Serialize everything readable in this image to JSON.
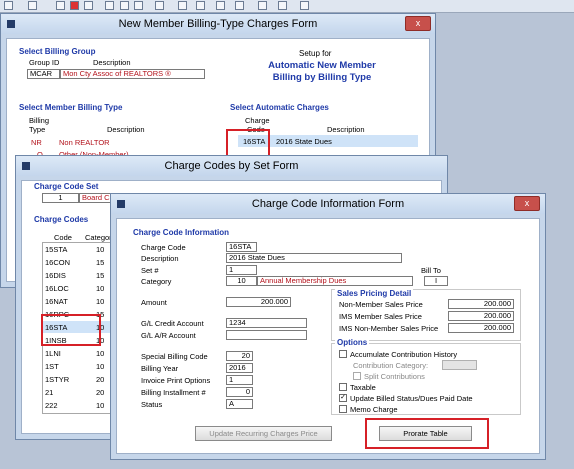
{
  "colors": {
    "accent": "#1f3aa8",
    "highlight": "#d62027",
    "window_bg": "#c6d6ea"
  },
  "toolbar": {
    "icons": [
      "print-icon",
      "pdf-icon",
      "edit-icon",
      "report-icon",
      "help-icon"
    ]
  },
  "billing_form": {
    "title": "New Member Billing-Type Charges Form",
    "close": "x",
    "select_billing_group": "Select Billing Group",
    "group_id_header": "Group ID",
    "description_header": "Description",
    "group_id": "MCAR",
    "group_desc": "Mon Cty Assoc of REALTORS ®",
    "setup_for": "Setup for",
    "setup_line1": "Automatic New Member",
    "setup_line2": "Billing by Billing Type",
    "select_member_billing_type": "Select Member Billing Type",
    "billing_type_header1": "Billing",
    "billing_type_header2": "Type",
    "bt_description_header": "Description",
    "billing_types": [
      {
        "code": "NR",
        "desc": "Non REALTOR"
      },
      {
        "code": "O",
        "desc": "Other (Non-Member)"
      }
    ],
    "select_automatic_charges": "Select Automatic Charges",
    "charge_code_header1": "Charge",
    "charge_code_header2": "Code",
    "ac_description_header": "Description",
    "auto_charge_code": "16STA",
    "auto_charge_desc": "2016 State Dues"
  },
  "set_form": {
    "title": "Charge Codes by Set Form",
    "charge_code_set": "Charge Code Set",
    "set_num": "1",
    "set_desc": "Board Cha",
    "charge_codes": "Charge Codes",
    "code_header": "Code",
    "category_header": "Categor",
    "codes": [
      {
        "code": "15STA",
        "cat": "10"
      },
      {
        "code": "16CON",
        "cat": "15"
      },
      {
        "code": "16DIS",
        "cat": "15"
      },
      {
        "code": "16LOC",
        "cat": "10"
      },
      {
        "code": "16NAT",
        "cat": "10"
      },
      {
        "code": "16RPC",
        "cat": "15"
      },
      {
        "code": "16STA",
        "cat": "10"
      },
      {
        "code": "1INSB",
        "cat": "10"
      },
      {
        "code": "1LNI",
        "cat": "10"
      },
      {
        "code": "1ST",
        "cat": "10"
      },
      {
        "code": "1STYR",
        "cat": "20"
      },
      {
        "code": "21",
        "cat": "20"
      },
      {
        "code": "222",
        "cat": "10"
      }
    ]
  },
  "info_form": {
    "title": "Charge Code Information Form",
    "close": "x",
    "section": "Charge Code Information",
    "charge_code_label": "Charge Code",
    "charge_code": "16STA",
    "description_label": "Description",
    "description": "2016 State Dues",
    "set_label": "Set #",
    "set": "1",
    "category_label": "Category",
    "category_num": "10",
    "category_desc": "Annual Membership Dues",
    "bill_to_label": "Bill To",
    "bill_to": "I",
    "amount_label": "Amount",
    "amount": "200.000",
    "gl_credit_label": "G/L Credit Account",
    "gl_credit": "1234",
    "gl_ar_label": "G/L  A/R Account",
    "gl_ar": "",
    "special_billing_label": "Special Billing Code",
    "special_billing": "20",
    "billing_year_label": "Billing Year",
    "billing_year": "2016",
    "invoice_print_label": "Invoice Print Options",
    "invoice_print": "1",
    "billing_installment_label": "Billing Installment #",
    "billing_installment": "0",
    "status_label": "Status",
    "status": "A",
    "sales_pricing": "Sales Pricing Detail",
    "non_member_price_label": "Non-Member Sales Price",
    "non_member_price": "200.000",
    "ims_member_price_label": "IMS Member Sales Price",
    "ims_member_price": "200.000",
    "ims_non_member_price_label": "IMS Non-Member Sales Price",
    "ims_non_member_price": "200.000",
    "options": "Options",
    "accumulate_label": "Accumulate Contribution History",
    "contribution_category_label": "Contribution Category:",
    "split_contributions_label": "Split Contributions",
    "taxable_label": "Taxable",
    "update_billed_label": "Update Billed Status/Dues Paid Date",
    "memo_charge_label": "Memo Charge",
    "checked_mark": "✓",
    "update_recurring_btn": "Update Recurring Charges Price",
    "prorate_btn": "Prorate Table"
  }
}
